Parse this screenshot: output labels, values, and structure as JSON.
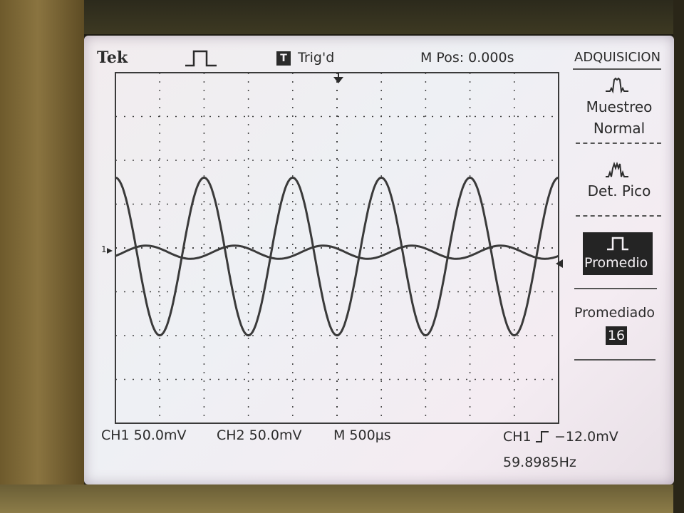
{
  "header": {
    "brand": "Tek",
    "trigger_status": "Trig'd",
    "trigger_icon": "T",
    "position": "M Pos: 0.000s"
  },
  "menu": {
    "title": "ADQUISICION",
    "items": [
      {
        "icon": "sample-mode-icon",
        "line1": "Muestreo",
        "line2": "Normal"
      },
      {
        "icon": "peak-detect-icon",
        "line1": "Det. Pico"
      },
      {
        "icon": "average-mode-icon",
        "line1": "Promedio",
        "selected": true
      }
    ],
    "averages_label": "Promediado",
    "averages_value": "16"
  },
  "footer": {
    "ch1_scale": "CH1  50.0mV",
    "ch2_scale": "CH2  50.0mV",
    "timebase": "M 500µs",
    "trigger_source": "CH1",
    "trigger_level": "−12.0mV",
    "frequency": "59.8985Hz"
  },
  "traces": {
    "ch1_cycles_shown": 5.0,
    "ch1_amplitude_div": 1.8,
    "ch2_amplitude_div": 0.15,
    "color": "#3a3a3a"
  }
}
